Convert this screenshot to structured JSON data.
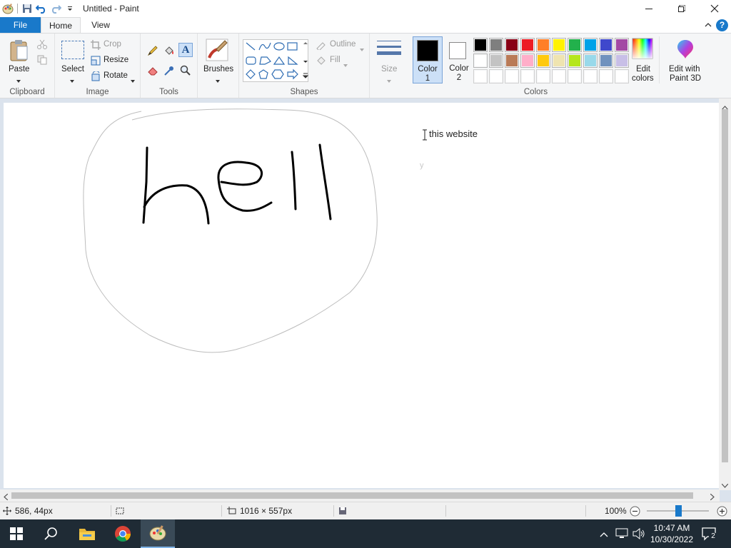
{
  "window": {
    "title": "Untitled - Paint"
  },
  "tabs": {
    "file": "File",
    "home": "Home",
    "view": "View"
  },
  "clipboard": {
    "paste": "Paste",
    "group": "Clipboard"
  },
  "image": {
    "select": "Select",
    "crop": "Crop",
    "resize": "Resize",
    "rotate": "Rotate",
    "group": "Image"
  },
  "tools": {
    "group": "Tools"
  },
  "brushes": {
    "label": "Brushes"
  },
  "shapes": {
    "outline": "Outline",
    "fill": "Fill",
    "group": "Shapes"
  },
  "size": {
    "label": "Size"
  },
  "colors": {
    "color1_line1": "Color",
    "color1_line2": "1",
    "color2_line1": "Color",
    "color2_line2": "2",
    "edit_line1": "Edit",
    "edit_line2": "colors",
    "paint3d_line1": "Edit with",
    "paint3d_line2": "Paint 3D",
    "group": "Colors",
    "palette_row1": [
      "#000000",
      "#7f7f7f",
      "#880015",
      "#ed1c24",
      "#ff7f27",
      "#fff200",
      "#22b14c",
      "#00a2e8",
      "#3f48cc",
      "#a349a4"
    ],
    "palette_row2": [
      "#ffffff",
      "#c3c3c3",
      "#b97a57",
      "#ffaec9",
      "#ffc90e",
      "#efe4b0",
      "#b5e61d",
      "#99d9ea",
      "#7092be",
      "#c8bfe7"
    ]
  },
  "canvas": {
    "drawn_text": "hell",
    "typed_text": "this website",
    "faint_text": "y"
  },
  "status": {
    "cursor_pos": "586, 44px",
    "canvas_size": "1016 × 557px",
    "zoom": "100%"
  },
  "taskbar": {
    "time": "10:47 AM",
    "date": "10/30/2022",
    "notifications": "2"
  }
}
